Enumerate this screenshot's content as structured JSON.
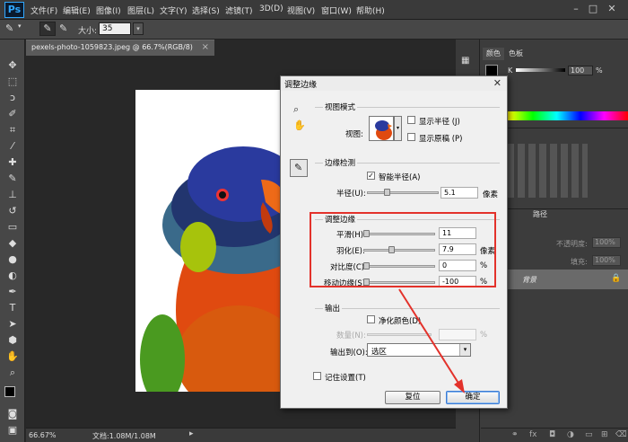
{
  "app": {
    "logo": "Ps"
  },
  "menubar": {
    "items": [
      "文件(F)",
      "编辑(E)",
      "图像(I)",
      "图层(L)",
      "文字(Y)",
      "选择(S)",
      "滤镜(T)",
      "3D(D)",
      "视图(V)",
      "窗口(W)",
      "帮助(H)"
    ]
  },
  "options": {
    "size_label": "大小:",
    "size_value": "35"
  },
  "document": {
    "tab_title": "pexels-photo-1059823.jpeg @ 66.7%(RGB/8)",
    "zoom": "66.67%",
    "doc_info": "文档:1.08M/1.08M"
  },
  "panels": {
    "color_tab": "颜色",
    "swatches_tab": "色板",
    "k_label": "K",
    "k_value": "100",
    "k_pct": "%",
    "paths_tab": "路径",
    "opacity_label": "不透明度:",
    "opacity_value": "100%",
    "fill_label": "填充:",
    "fill_value": "100%",
    "layer_name": "背景"
  },
  "dialog": {
    "title": "调整边缘",
    "view_mode": {
      "title": "视图模式",
      "view_label": "视图:",
      "show_radius": "显示半径 (J)",
      "show_original": "显示原稿 (P)"
    },
    "edge_detection": {
      "title": "边缘检测",
      "smart_radius": "智能半径(A)",
      "radius_label": "半径(U):",
      "radius_value": "5.1",
      "radius_unit": "像素"
    },
    "adjust_edge": {
      "title": "调整边缘",
      "smooth_label": "平滑(H):",
      "smooth_value": "11",
      "feather_label": "羽化(E):",
      "feather_value": "7.9",
      "feather_unit": "像素",
      "contrast_label": "对比度(C):",
      "contrast_value": "0",
      "contrast_unit": "%",
      "shift_label": "移动边缘(S):",
      "shift_value": "-100",
      "shift_unit": "%"
    },
    "output": {
      "title": "输出",
      "decontaminate": "净化颜色(D)",
      "amount_label": "数量(N):",
      "amount_unit": "%",
      "output_to_label": "输出到(O):",
      "output_to_value": "选区"
    },
    "remember": "记住设置(T)",
    "reset_button": "复位",
    "ok_button": "确定"
  },
  "colors": {
    "accent_red": "#e3322b",
    "ps_blue": "#31a8ff"
  }
}
